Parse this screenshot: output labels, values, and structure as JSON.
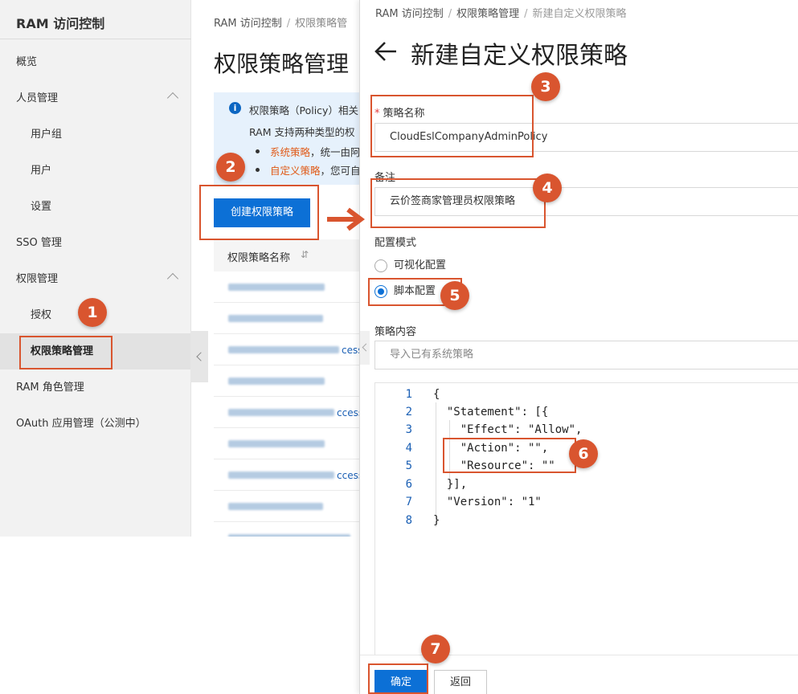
{
  "sidebar": {
    "title": "RAM 访问控制",
    "items": [
      {
        "label": "概览"
      },
      {
        "label": "人员管理"
      },
      {
        "label": "用户组"
      },
      {
        "label": "用户"
      },
      {
        "label": "设置"
      },
      {
        "label": "SSO 管理"
      },
      {
        "label": "权限管理"
      },
      {
        "label": "授权"
      },
      {
        "label": "权限策略管理"
      },
      {
        "label": "RAM 角色管理"
      },
      {
        "label": "OAuth 应用管理（公测中）"
      }
    ]
  },
  "bg_page": {
    "breadcrumb": [
      "RAM 访问控制",
      "权限策略管"
    ],
    "title": "权限策略管理",
    "info": {
      "line1": "权限策略（Policy）相关",
      "line2": "RAM 支持两种类型的权",
      "bullet1_link": "系统策略",
      "bullet1_text": "，统一由阿",
      "bullet2_link": "自定义策略",
      "bullet2_text": "，您可自"
    },
    "create_button": "创建权限策略",
    "table_header": "权限策略名称",
    "rows": [
      {
        "tail": ""
      },
      {
        "tail": ""
      },
      {
        "tail": "cess"
      },
      {
        "tail": ""
      },
      {
        "tail": "ccess"
      },
      {
        "tail": ""
      },
      {
        "tail": "ccess"
      },
      {
        "tail": ""
      },
      {
        "tail": ""
      }
    ]
  },
  "panel": {
    "breadcrumb": [
      "RAM 访问控制",
      "权限策略管理",
      "新建自定义权限策略"
    ],
    "title": "新建自定义权限策略",
    "name_label": "策略名称",
    "name_value": "CloudEslCompanyAdminPolicy",
    "note_label": "备注",
    "note_value": "云价签商家管理员权限策略",
    "mode_label": "配置模式",
    "mode_options": [
      "可视化配置",
      "脚本配置"
    ],
    "content_label": "策略内容",
    "import_placeholder": "导入已有系统策略",
    "code_lines": [
      {
        "num": "1",
        "text": "{"
      },
      {
        "num": "2",
        "text": "  \"Statement\": [{"
      },
      {
        "num": "3",
        "text": "    \"Effect\": \"Allow\","
      },
      {
        "num": "4",
        "text": "    \"Action\": \"\","
      },
      {
        "num": "5",
        "text": "    \"Resource\": \"\""
      },
      {
        "num": "6",
        "text": "  }],"
      },
      {
        "num": "7",
        "text": "  \"Version\": \"1\""
      },
      {
        "num": "8",
        "text": "}"
      }
    ],
    "ok_button": "确定",
    "back_button": "返回"
  },
  "annotations": {
    "steps": [
      "1",
      "2",
      "3",
      "4",
      "5",
      "6",
      "7"
    ],
    "color": "#d9552f"
  },
  "colors": {
    "primary": "#0c70d6",
    "link_orange": "#e05a17",
    "info_bg": "#e6f1fc"
  }
}
